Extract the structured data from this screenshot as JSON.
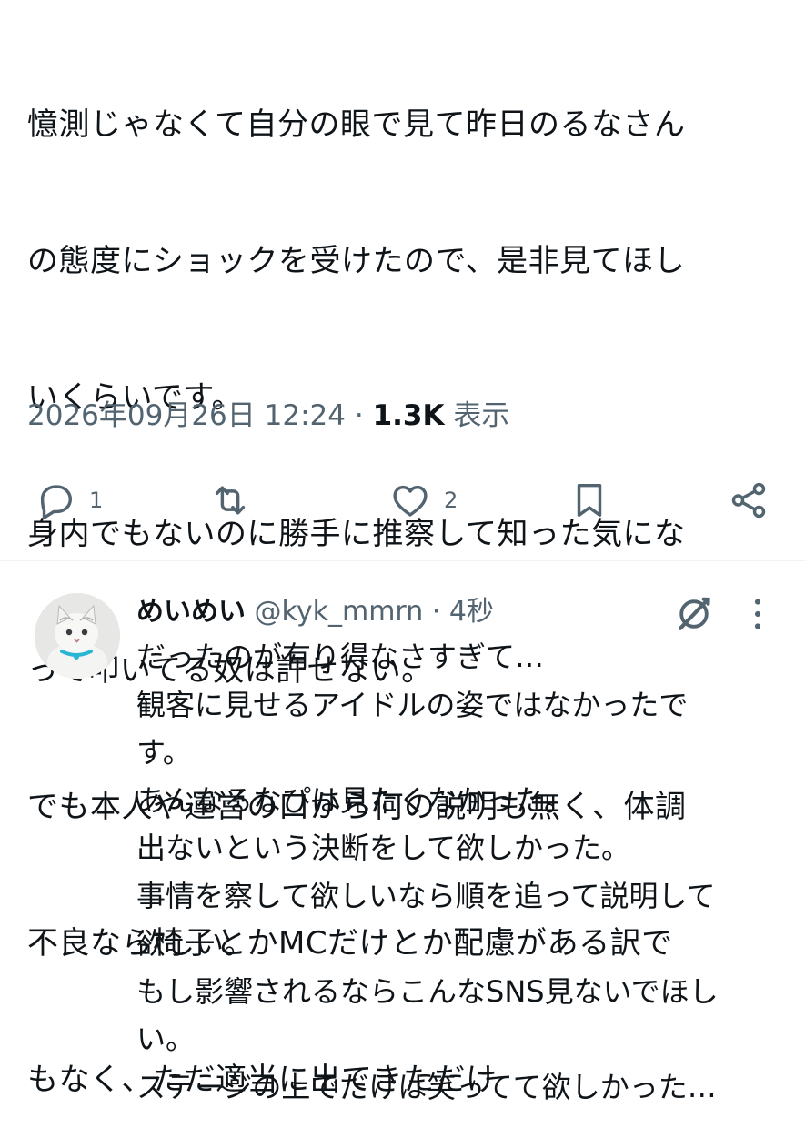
{
  "tweet": {
    "lines": [
      "憶測じゃなくて自分の眼で見て昨日のるなさん",
      "の態度にショックを受けたので、是非見てほし",
      "いくらいです。",
      "身内でもないのに勝手に推察して知った気にな",
      "って叩いてる奴は許せない。",
      "でも本人や運営の口から何の説明も無く、体調",
      "不良なら椅子とかMCだけとか配慮がある訳で",
      "もなく、ただ適当に出てきただけ"
    ],
    "timestamp": "2026年09月26日 12:24",
    "separator": "·",
    "views_count": "1.3K",
    "views_label": "表示"
  },
  "actions": {
    "reply_count": "1",
    "like_count": "2",
    "icons": [
      "reply-icon",
      "retweet-icon",
      "like-icon",
      "bookmark-icon",
      "share-icon"
    ]
  },
  "reply": {
    "name": "めいめい",
    "handle": "@kyk_mmrn",
    "separator": "·",
    "time": "4秒",
    "lines": [
      "だったのが有り得なさすぎて…",
      "観客に見せるアイドルの姿ではなかったで",
      "す。",
      "あんなるなぴは見たくなかった。",
      "出ないという決断をして欲しかった。",
      "事情を察して欲しいなら順を追って説明して",
      "欲しい。",
      "もし影響されるならこんなSNS見ないでほし",
      "い。",
      "ステージの上でだけは笑ってて欲しかった…"
    ]
  },
  "colors": {
    "text": "#0f1419",
    "secondary": "#536471",
    "divider": "#eff3f4"
  }
}
